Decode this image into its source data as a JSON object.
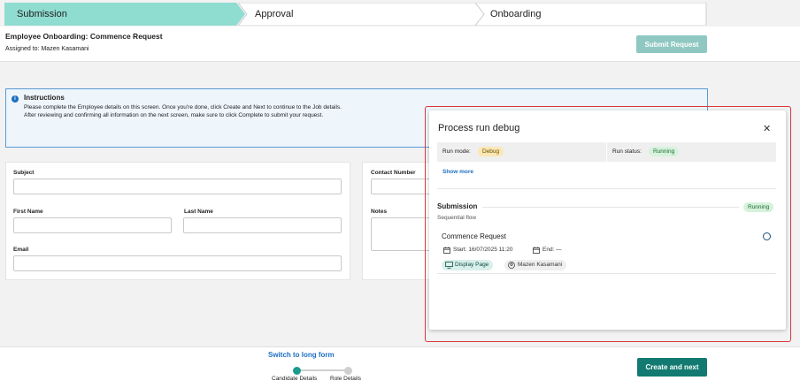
{
  "stepper": {
    "steps": [
      {
        "label": "Submission",
        "active": true
      },
      {
        "label": "Approval",
        "active": false
      },
      {
        "label": "Onboarding",
        "active": false
      }
    ],
    "active_color": "#8fdcd0"
  },
  "header": {
    "title": "Employee Onboarding: Commence Request",
    "assigned_to": "Assigned to: Mazen Kasamani",
    "submit_label": "Submit Request"
  },
  "instructions": {
    "title": "Instructions",
    "line1": "Please complete the Employee details on this screen. Once you're done, click Create and Next to continue to the Job details.",
    "line2": "After reviewing and confirming all information on the next screen, make sure to click Complete to submit your request."
  },
  "form": {
    "subject_label": "Subject",
    "first_name_label": "First Name",
    "last_name_label": "Last Name",
    "email_label": "Email",
    "contact_label": "Contact Number",
    "notes_label": "Notes",
    "subject_value": "",
    "first_name_value": "",
    "last_name_value": "",
    "email_value": "",
    "contact_value": "",
    "notes_value": ""
  },
  "footer": {
    "switch_label": "Switch to long form",
    "progress": [
      {
        "label": "Candidate Details",
        "done": true
      },
      {
        "label": "Role Details",
        "done": false
      }
    ],
    "create_label": "Create and next"
  },
  "debug": {
    "title": "Process run debug",
    "close_icon": "close-icon",
    "run_mode_label": "Run mode:",
    "run_mode_value": "Debug",
    "run_status_label": "Run status:",
    "run_status_value": "Running",
    "show_more": "Show more",
    "section_title": "Submission",
    "section_status": "Running",
    "section_subtitle": "Sequential flow",
    "task": {
      "title": "Commence Request",
      "start": "Start: 16/07/2025 11:20",
      "end": "End: —",
      "type_chip": "Display Page",
      "user_chip": "Mazen Kasamani"
    },
    "border_color": "#d9363e"
  }
}
